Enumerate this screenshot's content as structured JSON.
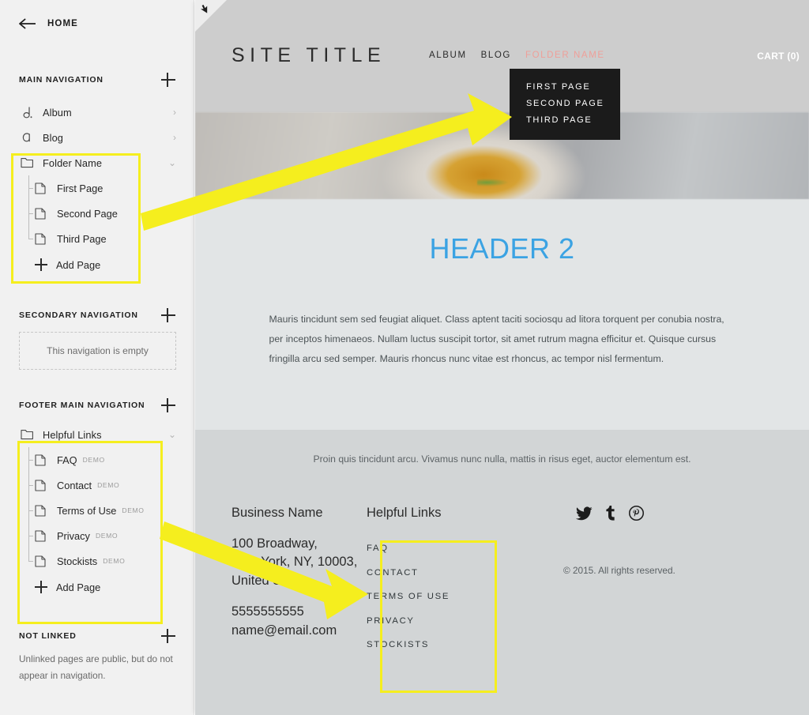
{
  "sidebar": {
    "back": {
      "label": "HOME",
      "icon": "back-arrow-icon"
    },
    "sections": [
      {
        "id": "main-navigation",
        "title": "MAIN NAVIGATION",
        "add_icon": "plus-icon",
        "items": [
          {
            "label": "Album",
            "icon": "music-note-icon",
            "chevron": "›"
          },
          {
            "label": "Blog",
            "icon": "letter-a-icon",
            "chevron": "›"
          },
          {
            "label": "Folder Name",
            "icon": "folder-icon",
            "chevron": "⌄"
          }
        ],
        "children": [
          {
            "label": "First Page",
            "icon": "page-icon"
          },
          {
            "label": "Second Page",
            "icon": "page-icon"
          },
          {
            "label": "Third Page",
            "icon": "page-icon"
          }
        ],
        "add_page_label": "Add Page"
      },
      {
        "id": "secondary-navigation",
        "title": "SECONDARY NAVIGATION",
        "empty_message": "This navigation is empty"
      },
      {
        "id": "footer-main-navigation",
        "title": "FOOTER MAIN NAVIGATION",
        "folder": {
          "label": "Helpful Links",
          "icon": "folder-icon",
          "chevron": "⌄"
        },
        "children": [
          {
            "label": "FAQ",
            "badge": "DEMO",
            "icon": "page-icon"
          },
          {
            "label": "Contact",
            "badge": "DEMO",
            "icon": "page-icon"
          },
          {
            "label": "Terms of Use",
            "badge": "DEMO",
            "icon": "page-icon"
          },
          {
            "label": "Privacy",
            "badge": "DEMO",
            "icon": "page-icon"
          },
          {
            "label": "Stockists",
            "badge": "DEMO",
            "icon": "page-icon"
          }
        ],
        "add_page_label": "Add Page"
      },
      {
        "id": "not-linked",
        "title": "NOT LINKED",
        "hint": "Unlinked pages are public, but do not appear in navigation."
      }
    ]
  },
  "preview": {
    "header": {
      "site_title": "SITE TITLE",
      "cart_label": "CART (0)",
      "nav": [
        {
          "label": "ALBUM",
          "active": false
        },
        {
          "label": "BLOG",
          "active": false
        },
        {
          "label": "FOLDER NAME",
          "active": true
        }
      ],
      "dropdown": [
        "FIRST PAGE",
        "SECOND PAGE",
        "THIRD PAGE"
      ],
      "corner_icon": "cursor-arrow-icon"
    },
    "body": {
      "heading": "HEADER 2",
      "paragraph": "Mauris tincidunt sem sed feugiat aliquet. Class aptent taciti sociosqu ad litora torquent per conubia nostra, per inceptos himenaeos. Nullam luctus suscipit tortor, sit amet rutrum magna efficitur et. Quisque cursus fringilla arcu sed semper. Mauris rhoncus nunc vitae est rhoncus, ac tempor nisl fermentum."
    },
    "footer": {
      "tagline": "Proin quis tincidunt arcu. Vivamus nunc nulla, mattis in risus eget, auctor elementum est.",
      "business_name": "Business Name",
      "address_line1": "100 Broadway,",
      "address_line2": "New York, NY, 10003,",
      "address_line3": "United States",
      "phone": "5555555555",
      "email": "name@email.com",
      "links_title": "Helpful Links",
      "links": [
        "FAQ",
        "CONTACT",
        "TERMS OF USE",
        "PRIVACY",
        "STOCKISTS"
      ],
      "social": [
        "twitter-icon",
        "tumblr-icon",
        "pinterest-icon"
      ],
      "copyright": "© 2015. All rights reserved."
    }
  },
  "annotations": {
    "highlight_color": "#f5ee1e",
    "arrow_color": "#f5ee1e",
    "accent_active": "#ef9f99",
    "heading_color": "#3ba3e3"
  }
}
